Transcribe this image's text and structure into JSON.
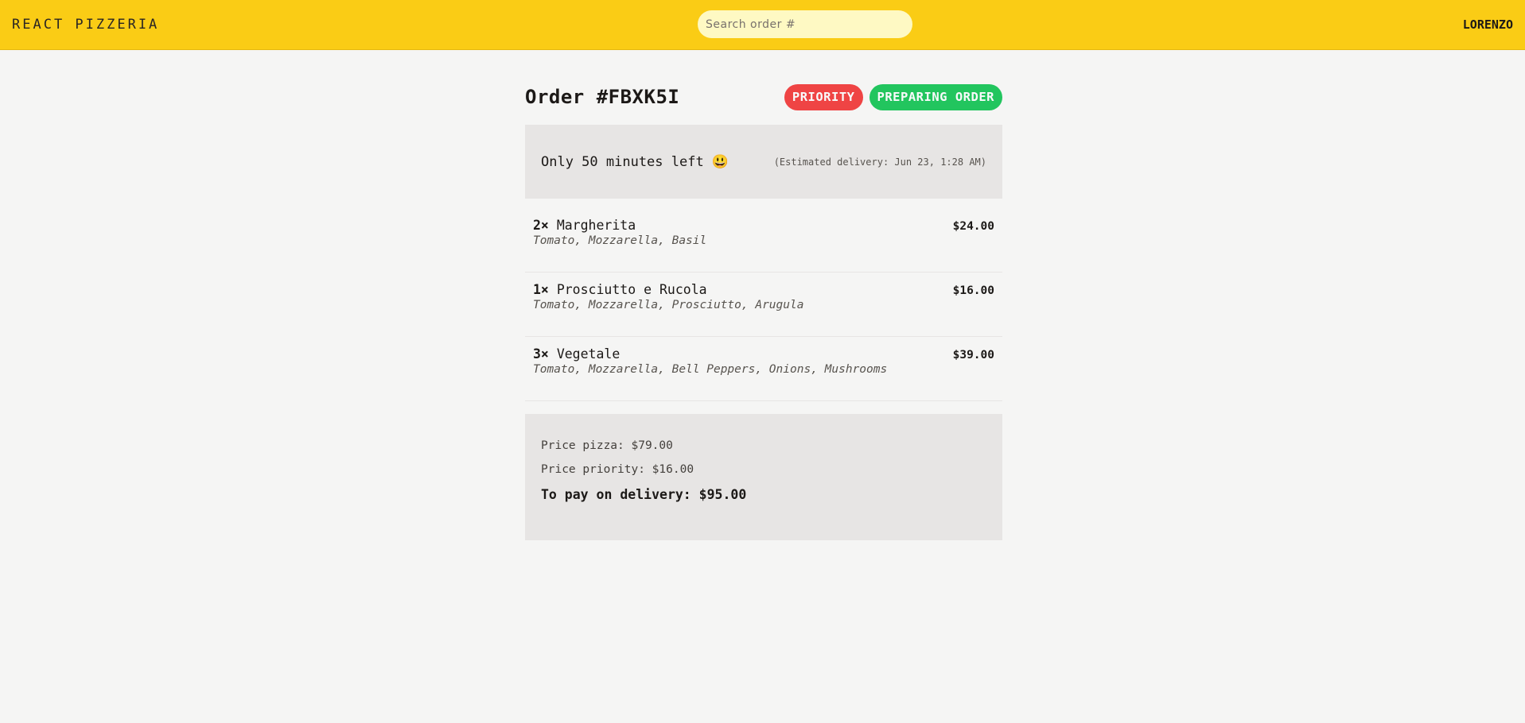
{
  "header": {
    "logo": "REACT PIZZERIA",
    "search_placeholder": "Search order #",
    "username": "LORENZO"
  },
  "order": {
    "title": "Order #FBXK5I",
    "badges": {
      "priority": "PRIORITY",
      "status": "PREPARING ORDER"
    },
    "eta": {
      "remaining": "Only 50 minutes left 😃",
      "estimated": "(Estimated delivery: Jun 23, 1:28 AM)"
    },
    "items": [
      {
        "qty": "2×",
        "name": "Margherita",
        "price": "$24.00",
        "ingredients": "Tomato, Mozzarella, Basil"
      },
      {
        "qty": "1×",
        "name": "Prosciutto e Rucola",
        "price": "$16.00",
        "ingredients": "Tomato, Mozzarella, Prosciutto, Arugula"
      },
      {
        "qty": "3×",
        "name": "Vegetale",
        "price": "$39.00",
        "ingredients": "Tomato, Mozzarella, Bell Peppers, Onions, Mushrooms"
      }
    ],
    "summary": {
      "price_pizza": "Price pizza: $79.00",
      "price_priority": "Price priority: $16.00",
      "total": "To pay on delivery: $95.00"
    }
  },
  "colors": {
    "header_bg": "#facc15",
    "priority": "#ef4444",
    "status": "#22c55e",
    "panel_bg": "#e7e5e4"
  }
}
